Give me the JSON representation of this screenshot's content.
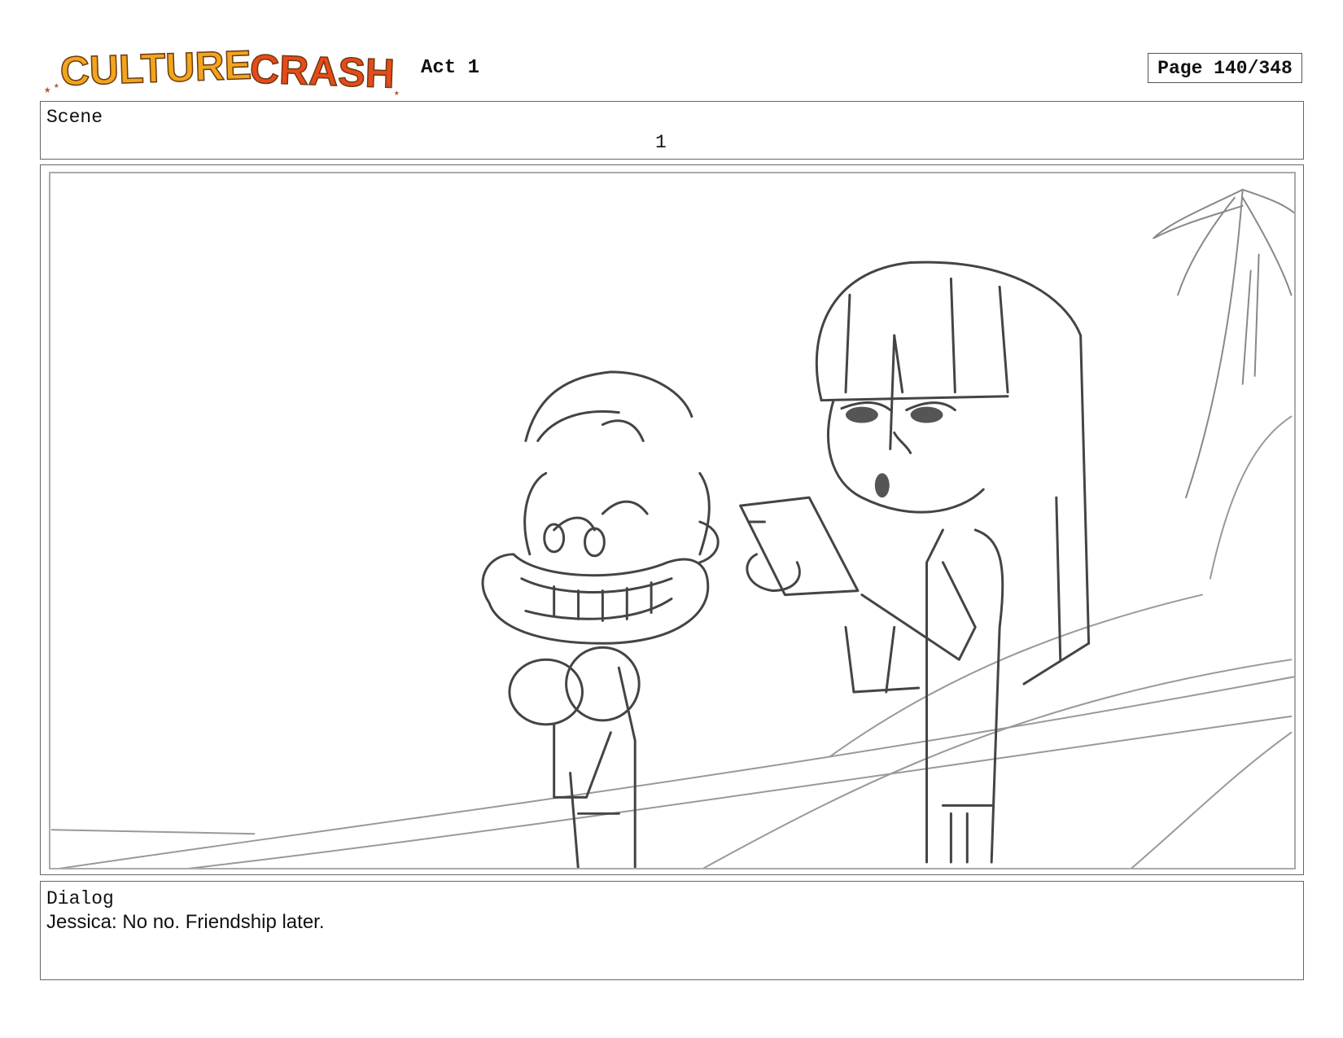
{
  "header": {
    "logo_text": "CULTURE CRASH",
    "act": "Act 1",
    "page": "Page 140/348"
  },
  "scene": {
    "label": "Scene",
    "number": "1"
  },
  "dialog": {
    "label": "Dialog",
    "text": "Jessica: No no. Friendship later."
  }
}
